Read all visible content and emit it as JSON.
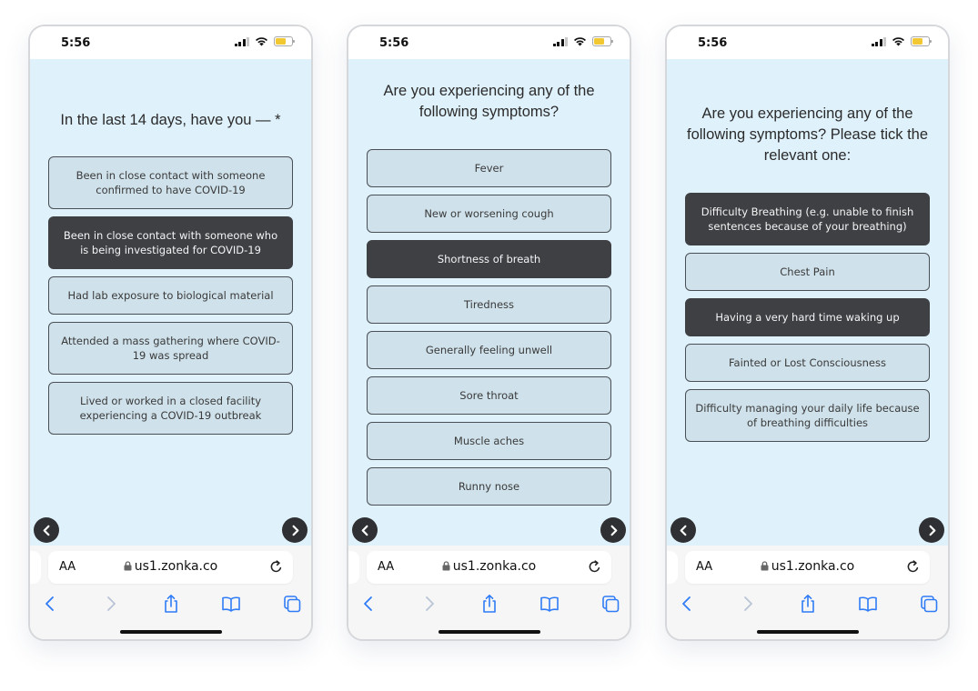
{
  "status": {
    "time": "5:56"
  },
  "browser": {
    "aa_label": "AA",
    "url": "us1.zonka.co"
  },
  "screens": [
    {
      "question": "In the last 14 days, have you — *",
      "options": [
        {
          "label": "Been in close contact with someone confirmed to have COVID-19",
          "selected": false
        },
        {
          "label": "Been in close contact with someone who is being investigated for COVID-19",
          "selected": true
        },
        {
          "label": "Had lab exposure to biological material",
          "selected": false
        },
        {
          "label": "Attended a mass gathering where COVID-19 was spread",
          "selected": false
        },
        {
          "label": "Lived or worked in a closed facility experiencing a COVID-19 outbreak",
          "selected": false
        }
      ]
    },
    {
      "question": "Are you experiencing any of the following symptoms?",
      "options": [
        {
          "label": "Fever",
          "selected": false
        },
        {
          "label": "New or worsening cough",
          "selected": false
        },
        {
          "label": "Shortness of breath",
          "selected": true
        },
        {
          "label": "Tiredness",
          "selected": false
        },
        {
          "label": "Generally feeling unwell",
          "selected": false
        },
        {
          "label": "Sore throat",
          "selected": false
        },
        {
          "label": "Muscle aches",
          "selected": false
        },
        {
          "label": "Runny nose",
          "selected": false
        }
      ]
    },
    {
      "question": "Are you experiencing any of the following symptoms? Please tick the relevant one:",
      "options": [
        {
          "label": "Difficulty Breathing (e.g. unable to finish sentences because of your breathing)",
          "selected": true
        },
        {
          "label": "Chest Pain",
          "selected": false
        },
        {
          "label": "Having a very hard time waking up",
          "selected": true
        },
        {
          "label": "Fainted or Lost Consciousness",
          "selected": false
        },
        {
          "label": "Difficulty managing your daily life because of breathing difficulties",
          "selected": false
        }
      ]
    }
  ],
  "colors": {
    "survey_background": "#dff1fb",
    "option_background": "#cfe1ea",
    "option_selected": "#3f4044",
    "nav_button": "#2f3033",
    "browser_chrome": "#f6f6f6",
    "safari_blue": "#2f7cf6",
    "battery": "#f2c832"
  },
  "icons": {
    "status": [
      "cellular-signal-icon",
      "wifi-icon",
      "battery-icon"
    ],
    "survey_nav": [
      "chevron-left-icon",
      "chevron-right-icon"
    ],
    "url_bar": [
      "lock-icon",
      "reload-icon"
    ],
    "toolbar": [
      "back-icon",
      "forward-icon",
      "share-icon",
      "bookmarks-icon",
      "tabs-icon"
    ]
  }
}
